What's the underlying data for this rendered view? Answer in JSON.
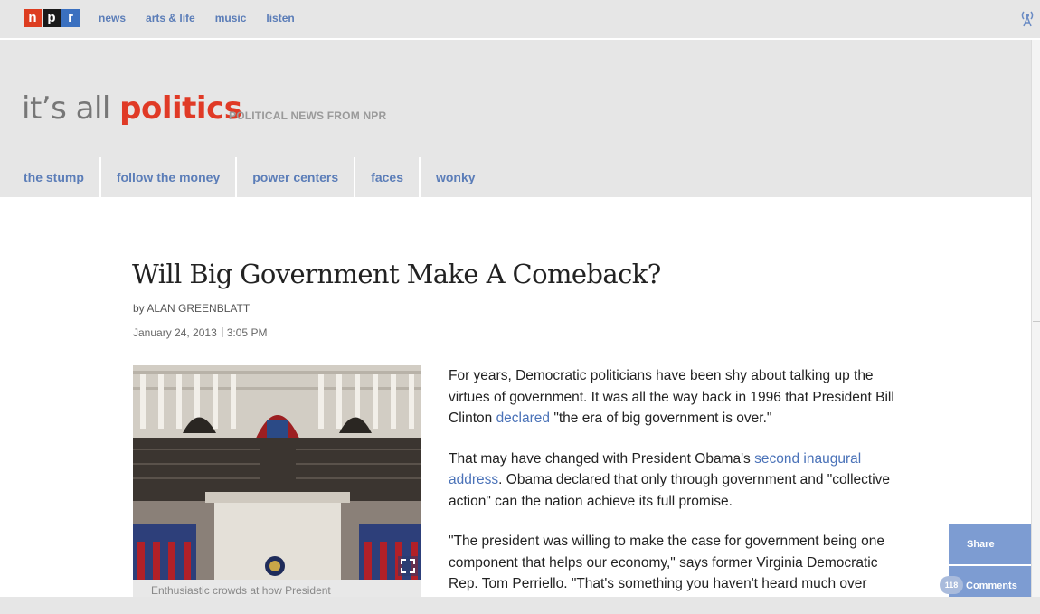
{
  "topbar": {
    "logo_letters": [
      "n",
      "p",
      "r"
    ],
    "nav": [
      "news",
      "arts & life",
      "music",
      "listen"
    ],
    "radio_icon": "radio-tower-icon"
  },
  "blog": {
    "title_prefix": "it’s all ",
    "title_accent": "politics",
    "tagline": "POLITICAL NEWS FROM NPR",
    "nav": [
      "the stump",
      "follow the money",
      "power centers",
      "faces",
      "wonky"
    ]
  },
  "article": {
    "headline": "Will Big Government Make A Comeback?",
    "by_label": "by",
    "author": "Alan Greenblatt",
    "date": "January 24, 2013",
    "time": "3:05 PM",
    "caption_partial": "Enthusiastic crowds at how President",
    "paragraphs": [
      {
        "before": "For years, Democratic politicians have been shy about talking up the virtues of government. It was all the way back in 1996 that President Bill Clinton ",
        "link": "declared",
        "after": " \"the era of big government is over.\""
      },
      {
        "before": "That may have changed with President Obama's ",
        "link": "second inaugural address",
        "after": ". Obama declared that only through government and \"collective action\" can the nation achieve its full promise."
      },
      {
        "before": "\"The president was willing to make the case for government being one component that helps our economy,\" says former Virginia Democratic Rep. Tom Perriello. \"That's something you haven't heard much over",
        "link": "",
        "after": ""
      }
    ]
  },
  "social": {
    "share_label": "Share",
    "comments_label": "Comments",
    "comments_count": "118"
  },
  "colors": {
    "npr_red": "#dd3d20",
    "npr_black": "#1a1a1a",
    "npr_blue": "#3a70c0",
    "accent_red": "#e03a26",
    "link_blue": "#5b7db8",
    "share_blue": "#7d9cd2"
  }
}
